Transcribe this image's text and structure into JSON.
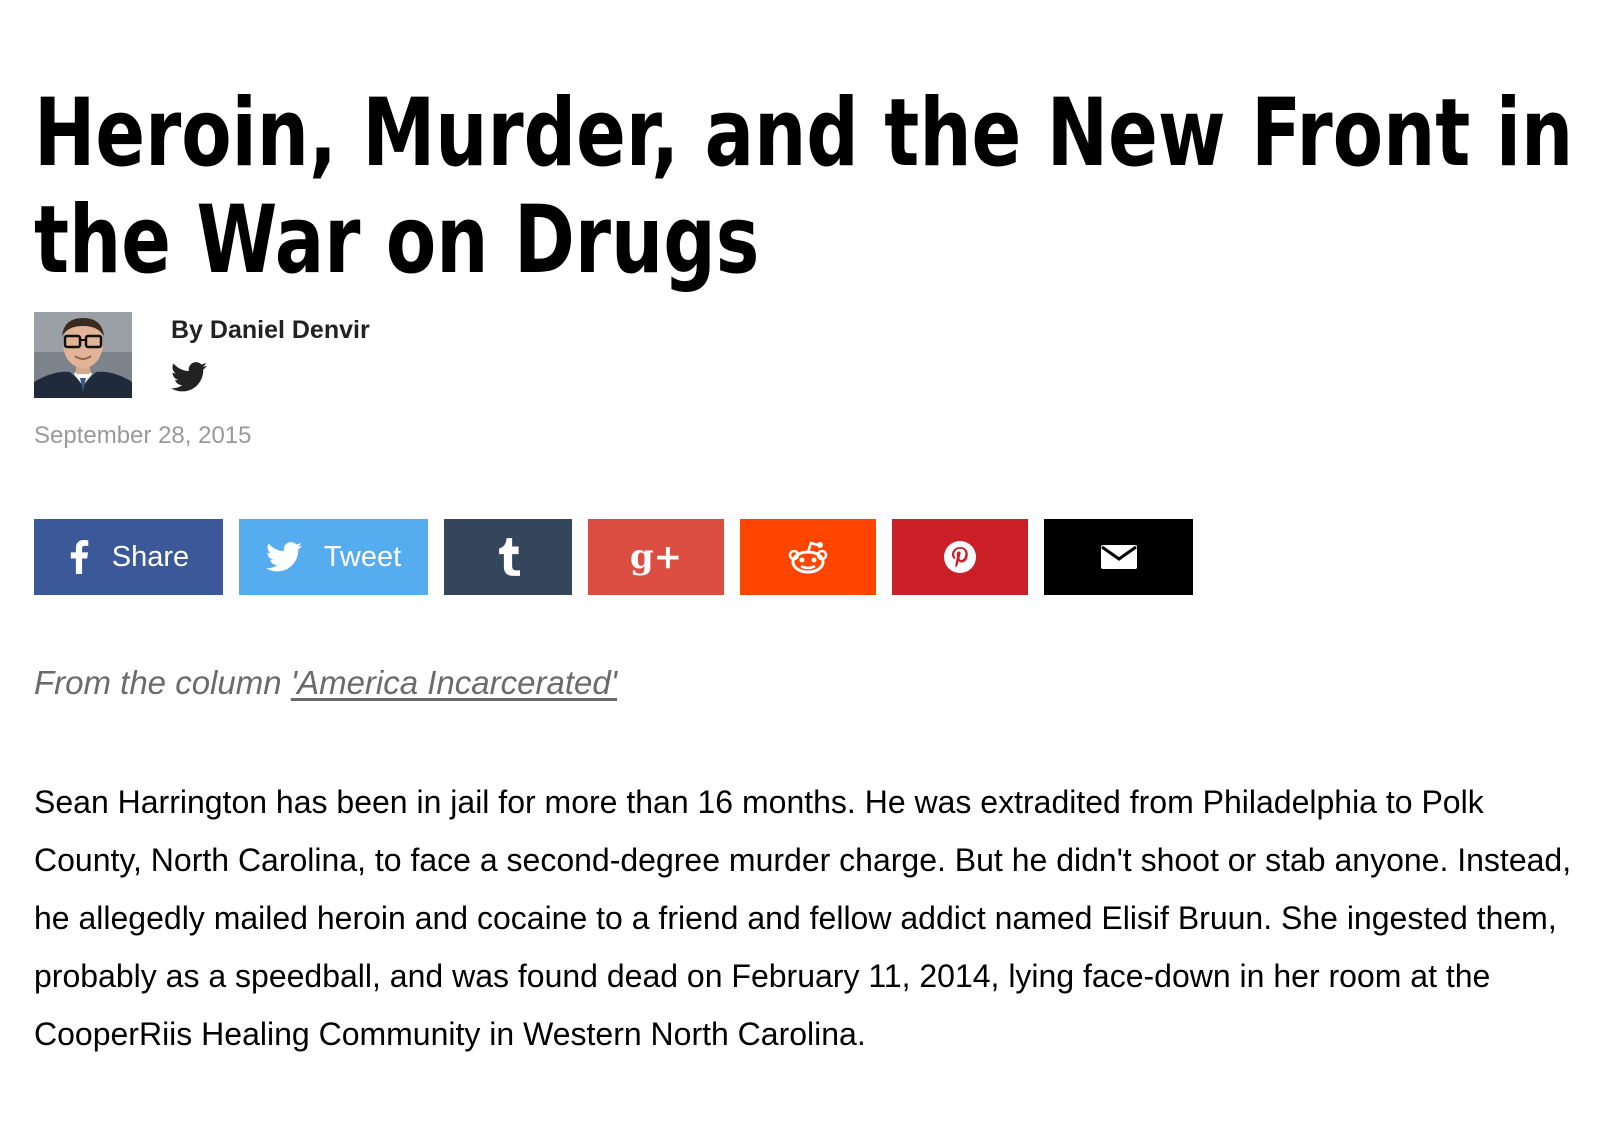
{
  "article": {
    "headline": "Heroin, Murder, and the New Front in the War on Drugs",
    "byline": "By Daniel Denvir",
    "author_social_icon": "twitter-icon",
    "date": "September 28, 2015",
    "share": [
      {
        "id": "facebook",
        "label": "Share",
        "icon": "facebook-icon",
        "color": "#3b5998"
      },
      {
        "id": "twitter",
        "label": "Tweet",
        "icon": "twitter-icon",
        "color": "#55acee"
      },
      {
        "id": "tumblr",
        "label": "",
        "icon": "tumblr-icon",
        "color": "#35465c"
      },
      {
        "id": "googleplus",
        "label": "",
        "icon": "google-plus-icon",
        "color": "#dc4e41"
      },
      {
        "id": "reddit",
        "label": "",
        "icon": "reddit-icon",
        "color": "#ff4500"
      },
      {
        "id": "pinterest",
        "label": "",
        "icon": "pinterest-icon",
        "color": "#cb2027"
      },
      {
        "id": "email",
        "label": "",
        "icon": "email-icon",
        "color": "#000000"
      }
    ],
    "column_prefix": "From the column",
    "column_link": "'America Incarcerated'",
    "lede": "Sean Harrington has been in jail for more than 16 months. He was extradited from Philadelphia to Polk County, North Carolina, to face a second-degree murder charge. But he didn't shoot or stab anyone. Instead, he allegedly mailed heroin and cocaine to a friend and fellow addict named Elisif Bruun. She ingested them, probably as a speedball, and was found dead on February 11, 2014, lying face-down in her room at the CooperRiis Healing Community in Western North Carolina."
  }
}
